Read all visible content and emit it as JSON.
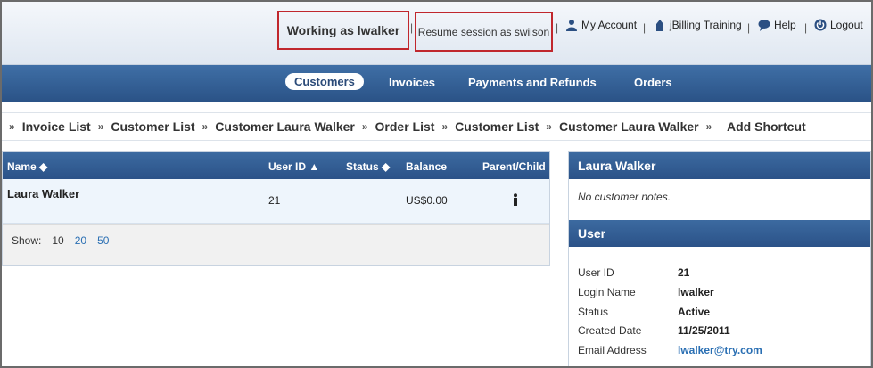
{
  "topbar": {
    "working_as": "Working as lwalker",
    "resume_session": "Resume session as swilson",
    "my_account": "My Account",
    "jbilling_training": "jBilling Training",
    "help": "Help",
    "logout": "Logout",
    "separator": "|"
  },
  "nav": {
    "items": [
      "Customers",
      "Invoices",
      "Payments and Refunds",
      "Orders"
    ],
    "active": "Customers"
  },
  "breadcrumbs": {
    "separator": "»",
    "items": [
      "Invoice List",
      "Customer List",
      "Customer Laura Walker",
      "Order List",
      "Customer List",
      "Customer Laura Walker"
    ],
    "add_shortcut": "Add Shortcut"
  },
  "customer_table": {
    "columns": {
      "name": "Name ◆",
      "user_id": "User ID ▲",
      "status": "Status ◆",
      "balance": "Balance",
      "parent_child": "Parent/Child"
    },
    "rows": [
      {
        "name": "Laura Walker",
        "user_id": "21",
        "status": "",
        "balance": "US$0.00",
        "parent_child_icon": "person-icon"
      }
    ],
    "pager": {
      "label": "Show:",
      "current": "10",
      "options": [
        "20",
        "50"
      ]
    }
  },
  "details": {
    "customer_name": "Laura Walker",
    "notes": "No customer notes.",
    "user_section": "User",
    "fields": [
      {
        "label": "User ID",
        "value": "21"
      },
      {
        "label": "Login Name",
        "value": "lwalker"
      },
      {
        "label": "Status",
        "value": "Active"
      },
      {
        "label": "Created Date",
        "value": "11/25/2011"
      },
      {
        "label": "Email Address",
        "value": "lwalker@try.com"
      }
    ]
  },
  "colors": {
    "accent_red": "#c0272d",
    "nav_blue": "#2a5286",
    "link_blue": "#2a6fb3"
  }
}
